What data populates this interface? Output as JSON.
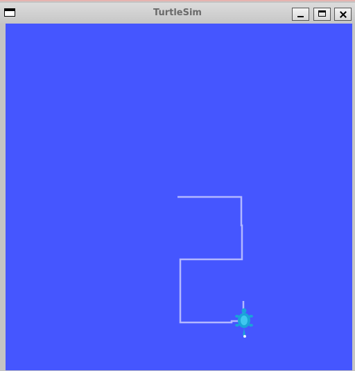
{
  "window": {
    "title": "TurtleSim",
    "buttons": {
      "menu": "window-menu",
      "minimize": "minimize",
      "maximize": "maximize",
      "close": "close"
    }
  },
  "canvas": {
    "background_color": "#4556ff",
    "pen_color": "#b3b8ff",
    "turtle_color": "#1aa3d9"
  }
}
